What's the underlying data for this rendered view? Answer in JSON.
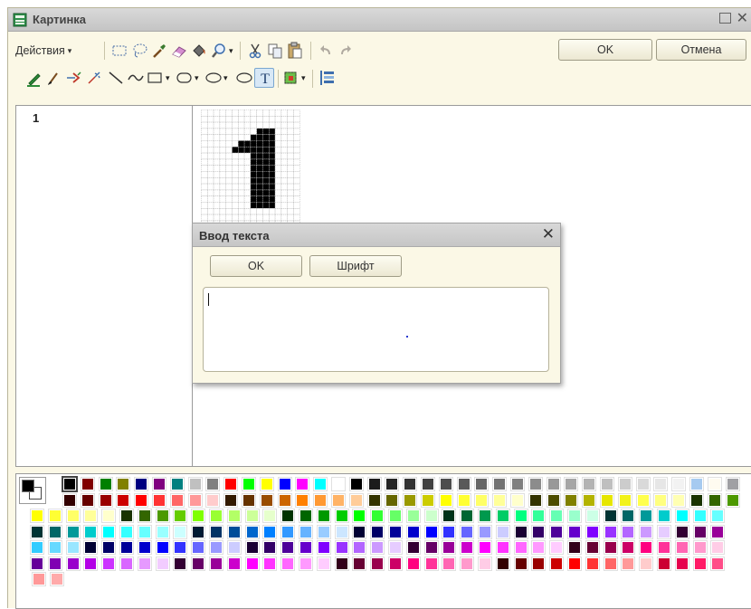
{
  "window": {
    "title": "Картинка"
  },
  "toolbar": {
    "actions_label": "Действия",
    "ok_label": "OK",
    "cancel_label": "Отмена",
    "row1_icons": [
      "select-rect-icon",
      "lasso-icon",
      "eyedropper-icon",
      "eraser-icon",
      "fill-bucket-icon",
      "zoom-icon",
      "cut-icon",
      "copy-icon",
      "paste-icon",
      "undo-icon",
      "redo-icon"
    ],
    "row2_icons": [
      "pencil-icon",
      "brush-icon",
      "spray-icon",
      "magic-icon",
      "line-icon",
      "curve-icon",
      "rectangle-icon",
      "rounded-rect-icon",
      "ellipse-icon",
      "text-icon",
      "color-fill-icon",
      "image-list-icon"
    ],
    "text_tool_glyph": "T"
  },
  "left_panel": {
    "items": [
      "1"
    ]
  },
  "canvas": {
    "pixels": [
      [
        0,
        0,
        0,
        0,
        0,
        0,
        0,
        0,
        0,
        0,
        0,
        0,
        0,
        0,
        0,
        0
      ],
      [
        0,
        0,
        0,
        0,
        0,
        0,
        0,
        0,
        0,
        0,
        0,
        0,
        0,
        0,
        0,
        0
      ],
      [
        0,
        0,
        0,
        0,
        0,
        0,
        0,
        0,
        0,
        0,
        0,
        0,
        0,
        0,
        0,
        0
      ],
      [
        0,
        0,
        0,
        0,
        0,
        0,
        0,
        0,
        0,
        1,
        1,
        1,
        0,
        0,
        0,
        0
      ],
      [
        0,
        0,
        0,
        0,
        0,
        0,
        0,
        0,
        1,
        1,
        1,
        1,
        0,
        0,
        0,
        0
      ],
      [
        0,
        0,
        0,
        0,
        0,
        0,
        1,
        1,
        1,
        1,
        1,
        1,
        0,
        0,
        0,
        0
      ],
      [
        0,
        0,
        0,
        0,
        0,
        1,
        1,
        1,
        1,
        1,
        1,
        1,
        0,
        0,
        0,
        0
      ],
      [
        0,
        0,
        0,
        0,
        0,
        0,
        0,
        0,
        1,
        1,
        1,
        1,
        0,
        0,
        0,
        0
      ],
      [
        0,
        0,
        0,
        0,
        0,
        0,
        0,
        0,
        1,
        1,
        1,
        1,
        0,
        0,
        0,
        0
      ],
      [
        0,
        0,
        0,
        0,
        0,
        0,
        0,
        0,
        1,
        1,
        1,
        1,
        0,
        0,
        0,
        0
      ],
      [
        0,
        0,
        0,
        0,
        0,
        0,
        0,
        0,
        1,
        1,
        1,
        1,
        0,
        0,
        0,
        0
      ],
      [
        0,
        0,
        0,
        0,
        0,
        0,
        0,
        0,
        1,
        1,
        1,
        1,
        0,
        0,
        0,
        0
      ],
      [
        0,
        0,
        0,
        0,
        0,
        0,
        0,
        0,
        1,
        1,
        1,
        1,
        0,
        0,
        0,
        0
      ],
      [
        0,
        0,
        0,
        0,
        0,
        0,
        0,
        0,
        1,
        1,
        1,
        1,
        0,
        0,
        0,
        0
      ],
      [
        0,
        0,
        0,
        0,
        0,
        0,
        0,
        0,
        1,
        1,
        1,
        1,
        0,
        0,
        0,
        0
      ],
      [
        0,
        0,
        0,
        0,
        0,
        0,
        0,
        0,
        1,
        1,
        1,
        1,
        0,
        0,
        0,
        0
      ],
      [
        0,
        0,
        0,
        0,
        0,
        0,
        0,
        0,
        0,
        0,
        0,
        0,
        0,
        0,
        0,
        0
      ],
      [
        0,
        0,
        0,
        0,
        0,
        0,
        0,
        0,
        0,
        0,
        0,
        0,
        0,
        0,
        0,
        0
      ],
      [
        0,
        0,
        0,
        0,
        0,
        0,
        0,
        0,
        0,
        0,
        0,
        0,
        0,
        0,
        0,
        0
      ],
      [
        0,
        0,
        0,
        0,
        0,
        0,
        0,
        0,
        0,
        0,
        0,
        0,
        0,
        0,
        0,
        0
      ],
      [
        0,
        0,
        0,
        0,
        0,
        0,
        0,
        0,
        0,
        0,
        0,
        0,
        0,
        0,
        0,
        0
      ],
      [
        0,
        0,
        0,
        0,
        0,
        0,
        0,
        0,
        0,
        0,
        0,
        0,
        0,
        0,
        0,
        0
      ]
    ]
  },
  "dialog": {
    "title": "Ввод текста",
    "ok_label": "OK",
    "font_label": "Шрифт",
    "text_value": ""
  },
  "palette": {
    "foreground": "#000000",
    "background": "#ffffff",
    "rows": [
      [
        "#000000",
        "#800000",
        "#008000",
        "#808000",
        "#000080",
        "#800080",
        "#008080",
        "#c0c0c0",
        "#808080",
        "#ff0000",
        "#00ff00",
        "#ffff00",
        "#0000ff",
        "#ff00ff",
        "#00ffff",
        "#ffffff",
        "#000000",
        "#1c1c1c",
        "#262626",
        "#333333",
        "#404040",
        "#4d4d4d",
        "#595959",
        "#666666",
        "#737373",
        "#808080",
        "#8c8c8c",
        "#999999",
        "#a6a6a6",
        "#b3b3b3",
        "#bfbfbf",
        "#cccccc",
        "#d9d9d9",
        "#e6e6e6",
        "#f2f2f2",
        "#a6caf0",
        "#fffbf0",
        "#a0a0a4",
        "#800000"
      ],
      [
        "#330000",
        "#660000",
        "#990000",
        "#cc0000",
        "#ff0000",
        "#ff3333",
        "#ff6666",
        "#ff9999",
        "#ffcccc",
        "#331a00",
        "#663300",
        "#994d00",
        "#cc6600",
        "#ff8000",
        "#ff9933",
        "#ffb366",
        "#ffcc99",
        "#333300",
        "#666600",
        "#999900",
        "#cccc00",
        "#ffff00",
        "#ffff33",
        "#ffff66",
        "#ffff99",
        "#ffffcc",
        "#333300",
        "#4d4d00",
        "#808000",
        "#b3b300",
        "#e6e600",
        "#f2f21a",
        "#ffff4d",
        "#ffff80",
        "#ffffb3",
        "#1a3300",
        "#336600",
        "#4d9900",
        "#66cc00"
      ],
      [
        "#ffff00",
        "#ffff33",
        "#ffff66",
        "#ffff99",
        "#ffffcc",
        "#1a3300",
        "#336600",
        "#4d9900",
        "#66cc00",
        "#80ff00",
        "#99ff33",
        "#b3ff66",
        "#ccff99",
        "#e6ffcc",
        "#003300",
        "#006600",
        "#009900",
        "#00cc00",
        "#00ff00",
        "#33ff33",
        "#66ff66",
        "#99ff99",
        "#ccffcc",
        "#00331a",
        "#006633",
        "#00994d",
        "#00cc66",
        "#00ff80",
        "#33ff99",
        "#66ffb3",
        "#99ffcc",
        "#ccffe6",
        "#003333",
        "#006666",
        "#009999",
        "#00cccc",
        "#00ffff",
        "#33ffff",
        "#66ffff"
      ],
      [
        "#003333",
        "#006666",
        "#009999",
        "#00cccc",
        "#00ffff",
        "#33ffff",
        "#66ffff",
        "#99ffff",
        "#ccffff",
        "#001a33",
        "#003366",
        "#004d99",
        "#0066cc",
        "#0080ff",
        "#3399ff",
        "#66b3ff",
        "#99ccff",
        "#cce6ff",
        "#000033",
        "#000066",
        "#000099",
        "#0000cc",
        "#0000ff",
        "#3333ff",
        "#6666ff",
        "#9999ff",
        "#ccccff",
        "#1a0033",
        "#330066",
        "#4d0099",
        "#6600cc",
        "#8000ff",
        "#9933ff",
        "#b366ff",
        "#cc99ff",
        "#e6ccff",
        "#330033",
        "#660066",
        "#990099"
      ],
      [
        "#33ccff",
        "#66d9ff",
        "#99e6ff",
        "#000033",
        "#000066",
        "#000099",
        "#0000cc",
        "#0000ff",
        "#3333ff",
        "#6666ff",
        "#9999ff",
        "#ccccff",
        "#1a0033",
        "#330066",
        "#4d0099",
        "#6600cc",
        "#8000ff",
        "#9933ff",
        "#b366ff",
        "#cc99ff",
        "#e6ccff",
        "#330033",
        "#660066",
        "#990099",
        "#cc00cc",
        "#ff00ff",
        "#ff33ff",
        "#ff66ff",
        "#ff99ff",
        "#ffccff",
        "#33001a",
        "#660033",
        "#99004d",
        "#cc0066",
        "#ff0080",
        "#ff3399",
        "#ff66b3",
        "#ff99cc",
        "#ffcce6"
      ],
      [
        "#660099",
        "#8000b3",
        "#9900cc",
        "#b300e6",
        "#cc33ff",
        "#d966ff",
        "#e699ff",
        "#f2ccff",
        "#330033",
        "#660066",
        "#990099",
        "#cc00cc",
        "#ff00ff",
        "#ff33ff",
        "#ff66ff",
        "#ff99ff",
        "#ffccff",
        "#33001a",
        "#660033",
        "#99004d",
        "#cc0066",
        "#ff0080",
        "#ff3399",
        "#ff66b3",
        "#ff99cc",
        "#ffcce6",
        "#330000",
        "#660000",
        "#990000",
        "#cc0000",
        "#ff0000",
        "#ff3333",
        "#ff6666",
        "#ff9999",
        "#ffcccc",
        "#cc0033",
        "#e6004d",
        "#ff1a66",
        "#ff4d88"
      ],
      [
        "#ff9999",
        "#ffaaaa"
      ]
    ]
  }
}
